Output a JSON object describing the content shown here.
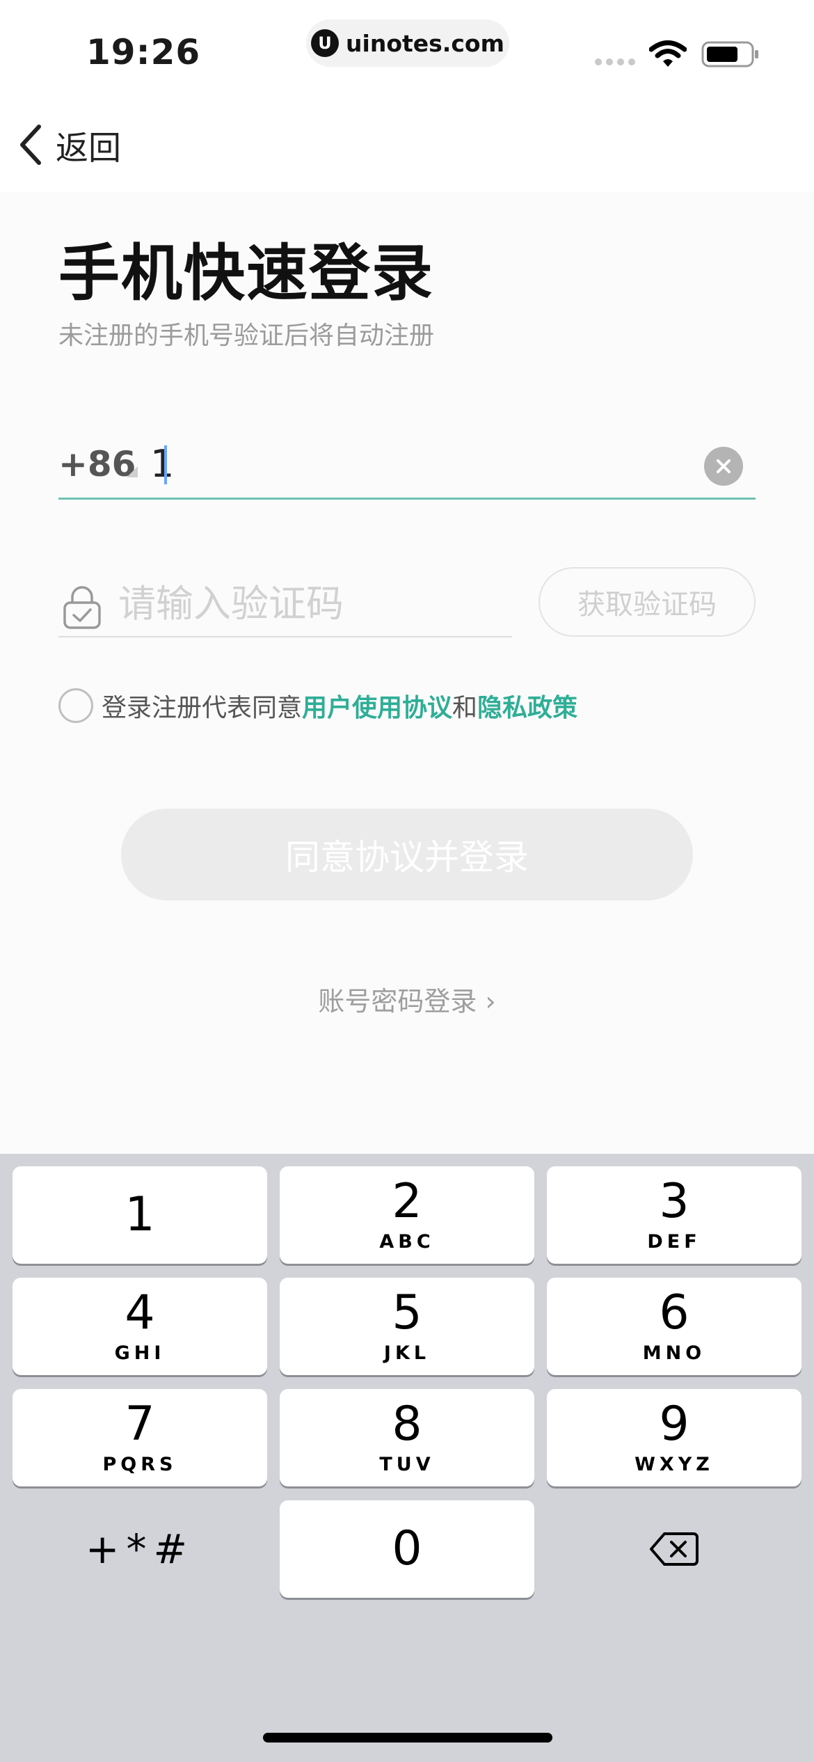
{
  "status_bar": {
    "time": "19:26",
    "url": "uinotes.com",
    "url_logo": "U"
  },
  "nav": {
    "back_label": "返回"
  },
  "header": {
    "title": "手机快速登录",
    "subtitle": "未注册的手机号验证后将自动注册"
  },
  "phone": {
    "country_code": "+86",
    "value": "1"
  },
  "code": {
    "placeholder": "请输入验证码",
    "get_code_label": "获取验证码"
  },
  "agreement": {
    "prefix": "登录注册代表同意",
    "user_agreement": "用户使用协议",
    "conjunction": "和",
    "privacy_policy": "隐私政策"
  },
  "actions": {
    "login_label": "同意协议并登录",
    "password_login_label": "账号密码登录 ›"
  },
  "keyboard": {
    "keys": [
      {
        "digit": "1",
        "letters": ""
      },
      {
        "digit": "2",
        "letters": "ABC"
      },
      {
        "digit": "3",
        "letters": "DEF"
      },
      {
        "digit": "4",
        "letters": "GHI"
      },
      {
        "digit": "5",
        "letters": "JKL"
      },
      {
        "digit": "6",
        "letters": "MNO"
      },
      {
        "digit": "7",
        "letters": "PQRS"
      },
      {
        "digit": "8",
        "letters": "TUV"
      },
      {
        "digit": "9",
        "letters": "WXYZ"
      },
      {
        "digit": "0",
        "letters": ""
      }
    ],
    "symbols_label": "+*#",
    "delete_icon": "backspace-icon"
  },
  "colors": {
    "accent": "#2fae96",
    "input_underline_active": "#6dc2b1",
    "disabled_button": "#ebebeb",
    "keyboard_bg": "#d1d3d9"
  }
}
